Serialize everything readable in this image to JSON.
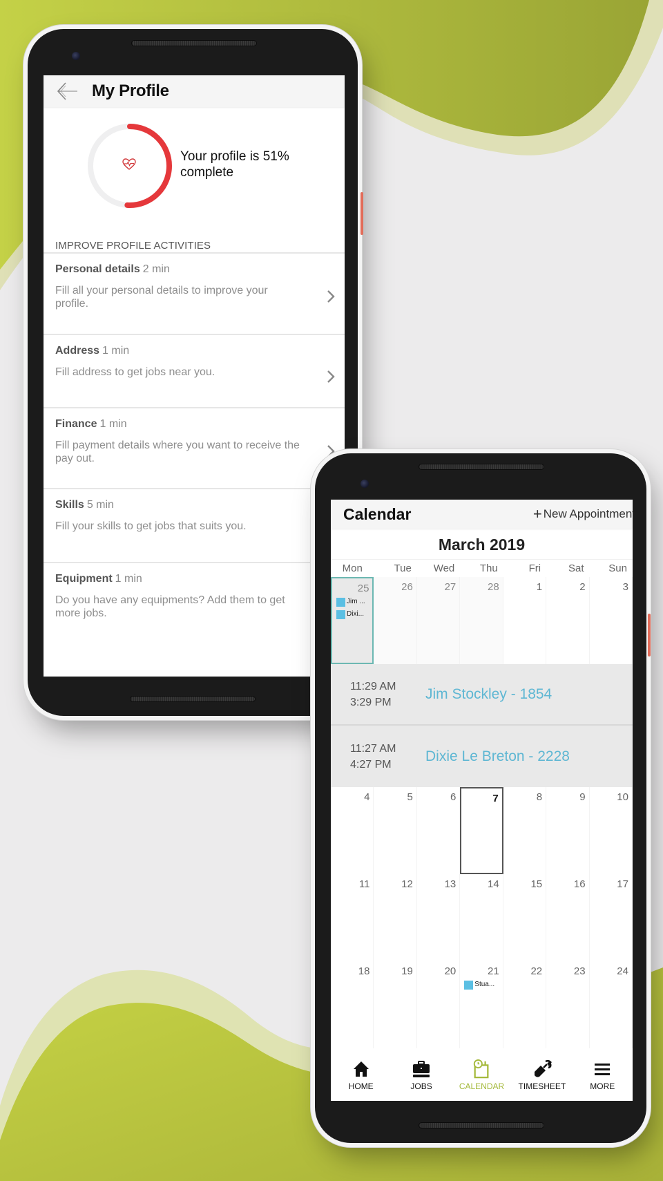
{
  "colors": {
    "accent_green": "#a4b93a",
    "progress_red": "#e5383b",
    "event_blue": "#5bbfe3",
    "appointment_link": "#5fb7d3",
    "selected_border": "#6cb8b2"
  },
  "profile": {
    "title": "My Profile",
    "progress_percent": 51,
    "progress_text": "Your profile is 51% complete",
    "section_label": "IMPROVE PROFILE ACTIVITIES",
    "activities": [
      {
        "name": "Personal details",
        "time": "2 min",
        "desc": "Fill all your personal details to improve your profile."
      },
      {
        "name": "Address",
        "time": "1 min",
        "desc": "Fill address to get jobs near you."
      },
      {
        "name": "Finance",
        "time": "1 min",
        "desc": "Fill payment details where you want to receive the pay out."
      },
      {
        "name": "Skills",
        "time": "5 min",
        "desc": "Fill your skills to get jobs that suits you."
      },
      {
        "name": "Equipment",
        "time": "1 min",
        "desc": "Do you have any equipments? Add them to get more jobs."
      }
    ]
  },
  "calendar": {
    "title": "Calendar",
    "new_appointment": "New Appointment",
    "month": "March 2019",
    "weekdays": [
      "Mon",
      "Tue",
      "Wed",
      "Thu",
      "Fri",
      "Sat",
      "Sun"
    ],
    "weeks": [
      [
        {
          "day": "25",
          "other": true,
          "selected": true,
          "events": [
            "Jim ...",
            "Dixi..."
          ]
        },
        {
          "day": "26",
          "other": true
        },
        {
          "day": "27",
          "other": true
        },
        {
          "day": "28",
          "other": true
        },
        {
          "day": "1"
        },
        {
          "day": "2"
        },
        {
          "day": "3"
        }
      ],
      [
        {
          "day": "4"
        },
        {
          "day": "5"
        },
        {
          "day": "6"
        },
        {
          "day": "7",
          "today": true
        },
        {
          "day": "8"
        },
        {
          "day": "9"
        },
        {
          "day": "10"
        }
      ],
      [
        {
          "day": "11"
        },
        {
          "day": "12"
        },
        {
          "day": "13"
        },
        {
          "day": "14"
        },
        {
          "day": "15"
        },
        {
          "day": "16"
        },
        {
          "day": "17"
        }
      ],
      [
        {
          "day": "18"
        },
        {
          "day": "19"
        },
        {
          "day": "20"
        },
        {
          "day": "21",
          "events": [
            "Stua..."
          ]
        },
        {
          "day": "22"
        },
        {
          "day": "23"
        },
        {
          "day": "24"
        }
      ]
    ],
    "appointments": [
      {
        "start": "11:29 AM",
        "end": "3:29 PM",
        "name": "Jim Stockley - 1854"
      },
      {
        "start": "11:27 AM",
        "end": "4:27 PM",
        "name": "Dixie Le Breton - 2228"
      }
    ],
    "tabs": [
      {
        "label": "HOME",
        "icon": "home-icon",
        "active": false
      },
      {
        "label": "JOBS",
        "icon": "briefcase-icon",
        "active": false
      },
      {
        "label": "CALENDAR",
        "icon": "calendar-clock-icon",
        "active": true
      },
      {
        "label": "TIMESHEET",
        "icon": "wrench-icon",
        "active": false
      },
      {
        "label": "MORE",
        "icon": "menu-icon",
        "active": false
      }
    ]
  }
}
